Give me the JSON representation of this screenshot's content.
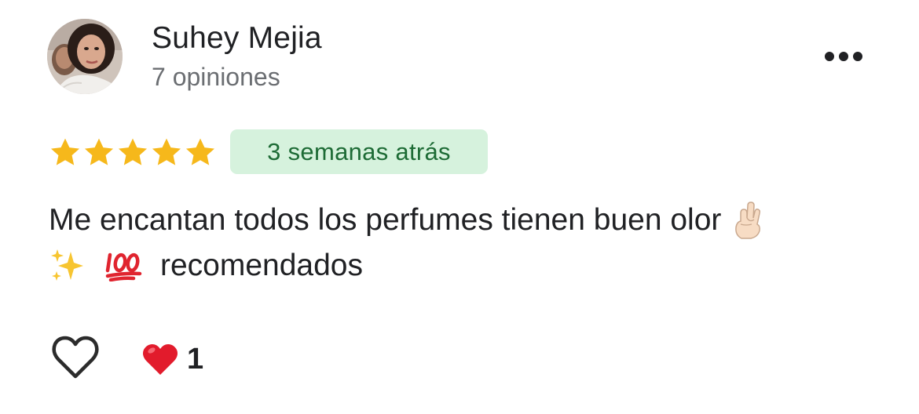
{
  "reviewer": {
    "name": "Suhey Mejia",
    "review_count": "7 opiniones"
  },
  "rating": {
    "stars": 5,
    "max_stars": 5,
    "star_color": "#f6b81b"
  },
  "time_badge": {
    "label": "3 semanas atrás",
    "background": "#d6f2dd",
    "text_color": "#1d6b35"
  },
  "review": {
    "line1_text": "Me encantan todos los perfumes tienen buen olor",
    "line1_emoji": "crossed-fingers-emoji",
    "line2_emojis": [
      "sparkles-emoji",
      "hundred-points-emoji"
    ],
    "line2_text": "recomendados"
  },
  "actions": {
    "like_icon": "heart-outline-icon",
    "reaction_icon": "red-heart-emoji",
    "reaction_count": "1"
  },
  "menu": {
    "icon": "more-horizontal-icon"
  }
}
